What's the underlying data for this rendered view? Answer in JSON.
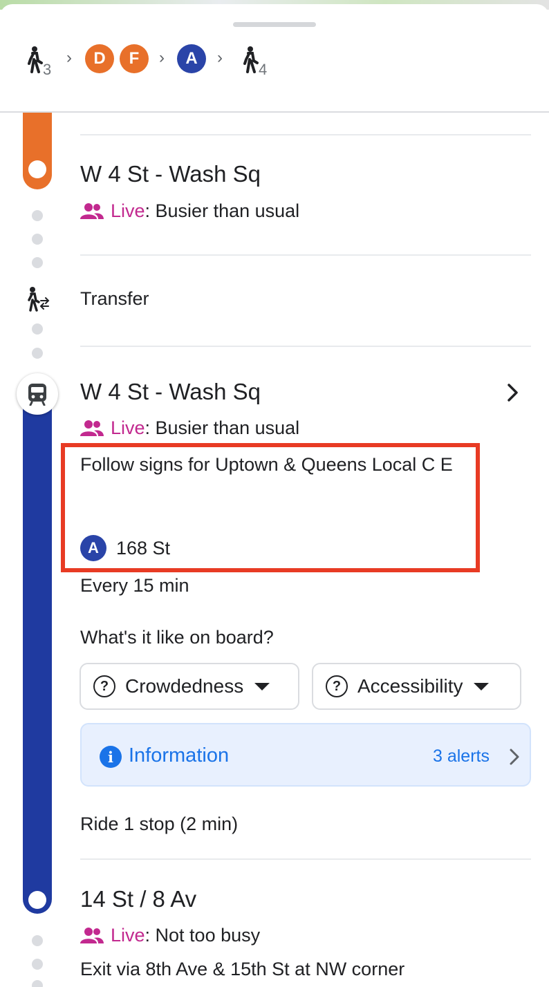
{
  "summary": {
    "steps": [
      {
        "kind": "walk",
        "minutes": "3"
      },
      {
        "kind": "lines",
        "lines": [
          "D",
          "F"
        ]
      },
      {
        "kind": "lines",
        "lines": [
          "A"
        ]
      },
      {
        "kind": "walk",
        "minutes": "4"
      }
    ]
  },
  "colors": {
    "orange_line": "#e8702a",
    "blue_line": "#1f3aa0",
    "live": "#c2298f",
    "link": "#1a73e8",
    "highlight": "#e83b24"
  },
  "stop1": {
    "name": "W 4 St - Wash Sq",
    "live_label": "Live",
    "live_status": ": Busier than usual"
  },
  "transfer": {
    "label": "Transfer"
  },
  "stop2": {
    "name": "W 4 St - Wash Sq",
    "live_label": "Live",
    "live_status": ": Busier than usual",
    "follow": "Follow signs for Uptown & Queens Local C E",
    "line": "A",
    "destination": "168 St",
    "frequency": "Every 15 min",
    "onboard_question": "What's it like on board?",
    "chips": [
      "Crowdedness",
      "Accessibility"
    ],
    "info_title": "Information",
    "info_alerts": "3 alerts",
    "ride": "Ride 1 stop (2 min)"
  },
  "stop3": {
    "name": "14 St / 8 Av",
    "live_label": "Live",
    "live_status": ": Not too busy",
    "exit": "Exit via 8th Ave & 15th St at NW corner"
  }
}
